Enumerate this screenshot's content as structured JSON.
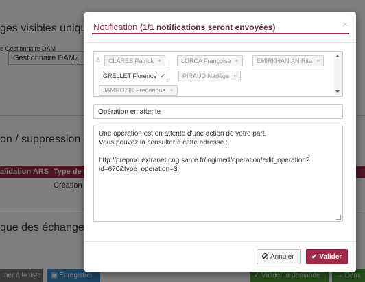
{
  "background": {
    "heading1": "ges visibles uniqu",
    "small_label": "e Gestionnaire DAM",
    "dam_box_label": "Gestionnaire DAM",
    "heading2": "on / suppression de",
    "table_headers": [
      "alidation ARS",
      "Type de m"
    ],
    "cell1": "Création d",
    "heading3": "que des échanges",
    "btn_list": "ner à la liste",
    "btn_save": "Enregistrer",
    "btn_validate": "Valider la demande",
    "btn_right": "Dem"
  },
  "modal": {
    "title": "Notification",
    "subtitle": "(1/1 notifications seront envoyées)",
    "close": "×",
    "recipients_prefix": "à",
    "recipients": [
      {
        "name": "CLARES Patrick",
        "mark": "+"
      },
      {
        "name": "LORCA Françoise",
        "mark": "+"
      },
      {
        "name": "EMIRKHANIAN Rita",
        "mark": "+"
      },
      {
        "name": "GRELLET Florence",
        "mark": "✓"
      },
      {
        "name": "PIRAUD Nadège",
        "mark": "+"
      },
      {
        "name": "JAMROZIK Frédérique",
        "mark": "+"
      }
    ],
    "subject": "Opération en attente",
    "body_lines": [
      "Une opération est en attente d'une action de votre part.",
      "Vous pouvez la consulter à cette adresse :",
      "",
      "http://preprod.extranet.cng.sante.fr/logimed/operation/edit_operation?",
      "id=670&type_operation=3"
    ],
    "cancel_label": "Annuler",
    "ok_label": "Valider"
  },
  "colors": {
    "accent": "#a12a48",
    "check": "#4a9a3a"
  }
}
